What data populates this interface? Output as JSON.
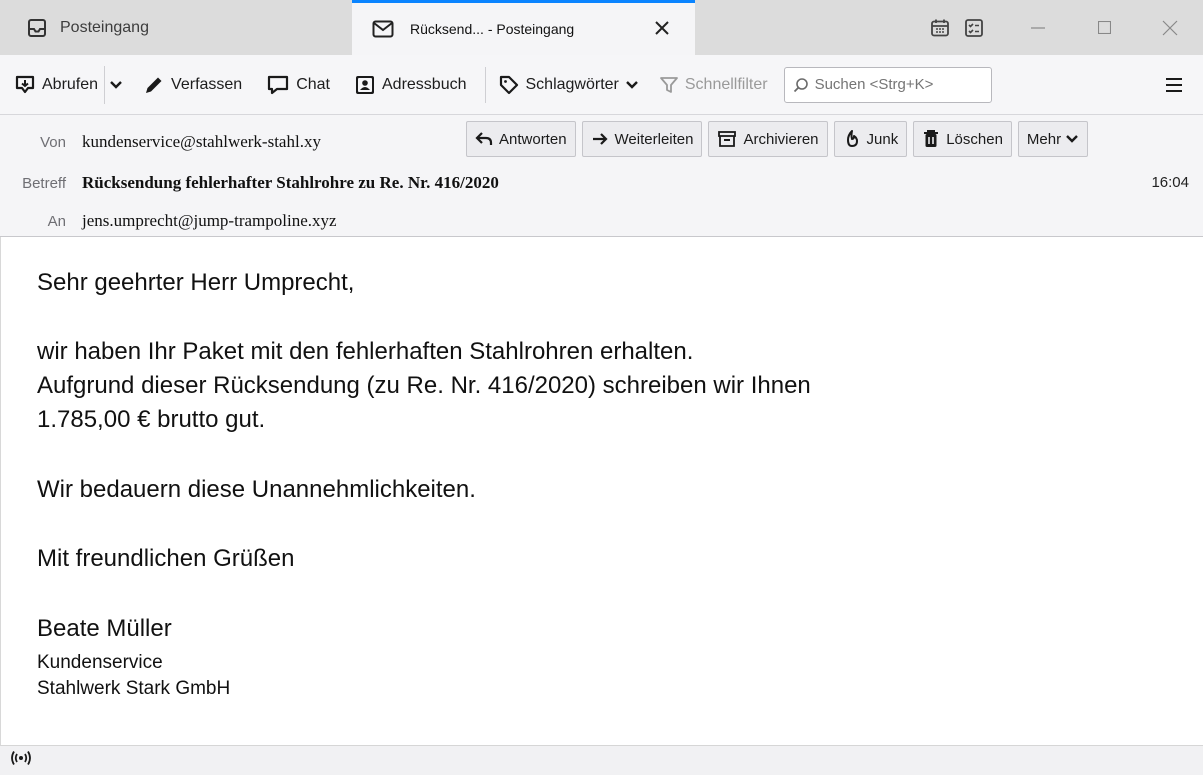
{
  "tabs": [
    {
      "label": "Posteingang",
      "icon": "inbox-icon",
      "active": false
    },
    {
      "label": "Rücksend... - Posteingang",
      "icon": "envelope-icon",
      "active": true
    }
  ],
  "toolbar": {
    "get_mail": "Abrufen",
    "write": "Verfassen",
    "chat": "Chat",
    "address_book": "Adressbuch",
    "tags": "Schlagwörter",
    "quick_filter": "Schnellfilter",
    "search_placeholder": "Suchen <Strg+K>"
  },
  "header": {
    "from_label": "Von",
    "from": "kundenservice@stahlwerk-stahl.xy",
    "subject_label": "Betreff",
    "subject": "Rücksendung fehlerhafter Stahlrohre zu Re. Nr. 416/2020",
    "to_label": "An",
    "to": "jens.umprecht@jump-trampoline.xyz",
    "time": "16:04",
    "actions": {
      "reply": "Antworten",
      "forward": "Weiterleiten",
      "archive": "Archivieren",
      "junk": "Junk",
      "delete": "Löschen",
      "more": "Mehr"
    }
  },
  "body": {
    "greeting": "Sehr geehrter Herr Umprecht,",
    "line1": "wir haben Ihr Paket mit den fehlerhaften Stahlrohren erhalten.",
    "line2": "Aufgrund dieser Rücksendung (zu Re. Nr. 416/2020) schreiben wir Ihnen",
    "line3": "1.785,00 € brutto gut.",
    "apology": "Wir bedauern diese Unannehmlichkeiten.",
    "closing": "Mit freundlichen Grüßen",
    "signature_name": "Beate Müller",
    "signature_dept": "Kundenservice",
    "signature_company": "Stahlwerk Stark GmbH"
  },
  "colors": {
    "accent": "#0a84ff",
    "titlebar": "#dcdcdc",
    "header_bg": "#f5f5f7"
  }
}
